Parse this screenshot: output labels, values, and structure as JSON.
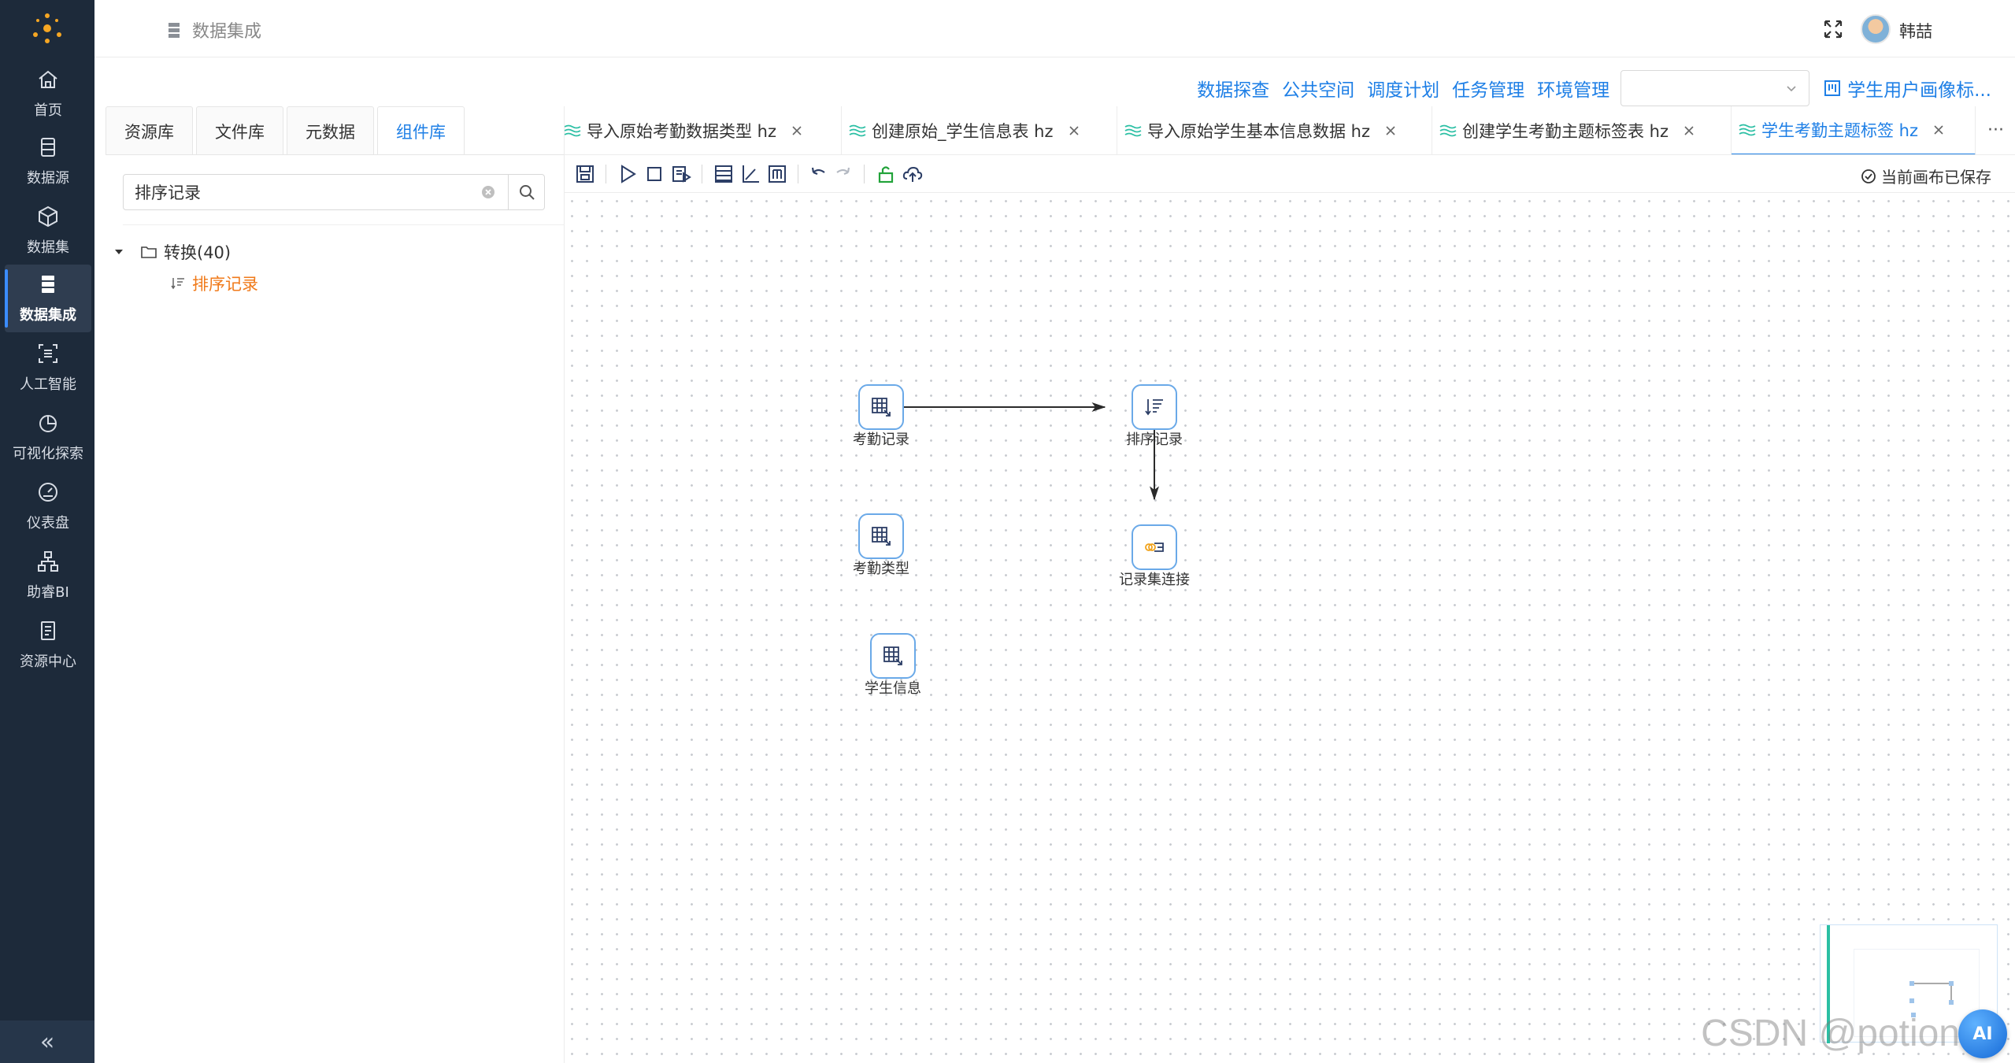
{
  "sidebar": {
    "items": [
      {
        "label": "首页",
        "icon": "home-icon"
      },
      {
        "label": "数据源",
        "icon": "database-icon"
      },
      {
        "label": "数据集",
        "icon": "cube-icon"
      },
      {
        "label": "数据集成",
        "icon": "server-stack-icon",
        "active": true
      },
      {
        "label": "人工智能",
        "icon": "ai-scan-icon"
      },
      {
        "label": "可视化探索",
        "icon": "pie-chart-icon"
      },
      {
        "label": "仪表盘",
        "icon": "gauge-icon"
      },
      {
        "label": "助睿BI",
        "icon": "org-tree-icon"
      },
      {
        "label": "资源中心",
        "icon": "document-icon"
      }
    ],
    "collapse_label": "«"
  },
  "header": {
    "breadcrumb": "数据集成",
    "username": "韩喆"
  },
  "toplinks": [
    "数据探查",
    "公共空间",
    "调度计划",
    "任务管理",
    "环境管理"
  ],
  "env_select": {
    "value": ""
  },
  "profile_link": "学生用户画像标...",
  "left_panel": {
    "tabs": [
      "资源库",
      "文件库",
      "元数据",
      "组件库"
    ],
    "active_tab": "组件库",
    "search": {
      "value": "排序记录",
      "placeholder": ""
    },
    "tree": {
      "folder_label": "转换(40)",
      "child_label": "排序记录"
    }
  },
  "doc_tabs": [
    {
      "label": "导入原始考勤数据类型 hz"
    },
    {
      "label": "创建原始_学生信息表 hz"
    },
    {
      "label": "导入原始学生基本信息数据 hz"
    },
    {
      "label": "创建学生考勤主题标签表 hz"
    },
    {
      "label": "学生考勤主题标签 hz",
      "active": true
    }
  ],
  "more_tabs": "···",
  "toolbar": {
    "saved_status": "当前画布已保存"
  },
  "canvas": {
    "nodes": [
      {
        "id": "n1",
        "label": "考勤记录",
        "icon": "table-input-icon"
      },
      {
        "id": "n2",
        "label": "排序记录",
        "icon": "sort-icon"
      },
      {
        "id": "n3",
        "label": "考勤类型",
        "icon": "table-input-icon"
      },
      {
        "id": "n4",
        "label": "记录集连接",
        "icon": "merge-join-icon"
      },
      {
        "id": "n5",
        "label": "学生信息",
        "icon": "table-input-icon"
      }
    ],
    "edges": [
      {
        "from": "n1",
        "to": "n2"
      },
      {
        "from": "n2",
        "to": "n4"
      }
    ]
  },
  "ai_button": "AI",
  "watermark": "CSDN @potion",
  "colors": {
    "sidebar_bg": "#1d2a3a",
    "accent": "#1e7fe6",
    "tree_highlight": "#f07a1a"
  }
}
